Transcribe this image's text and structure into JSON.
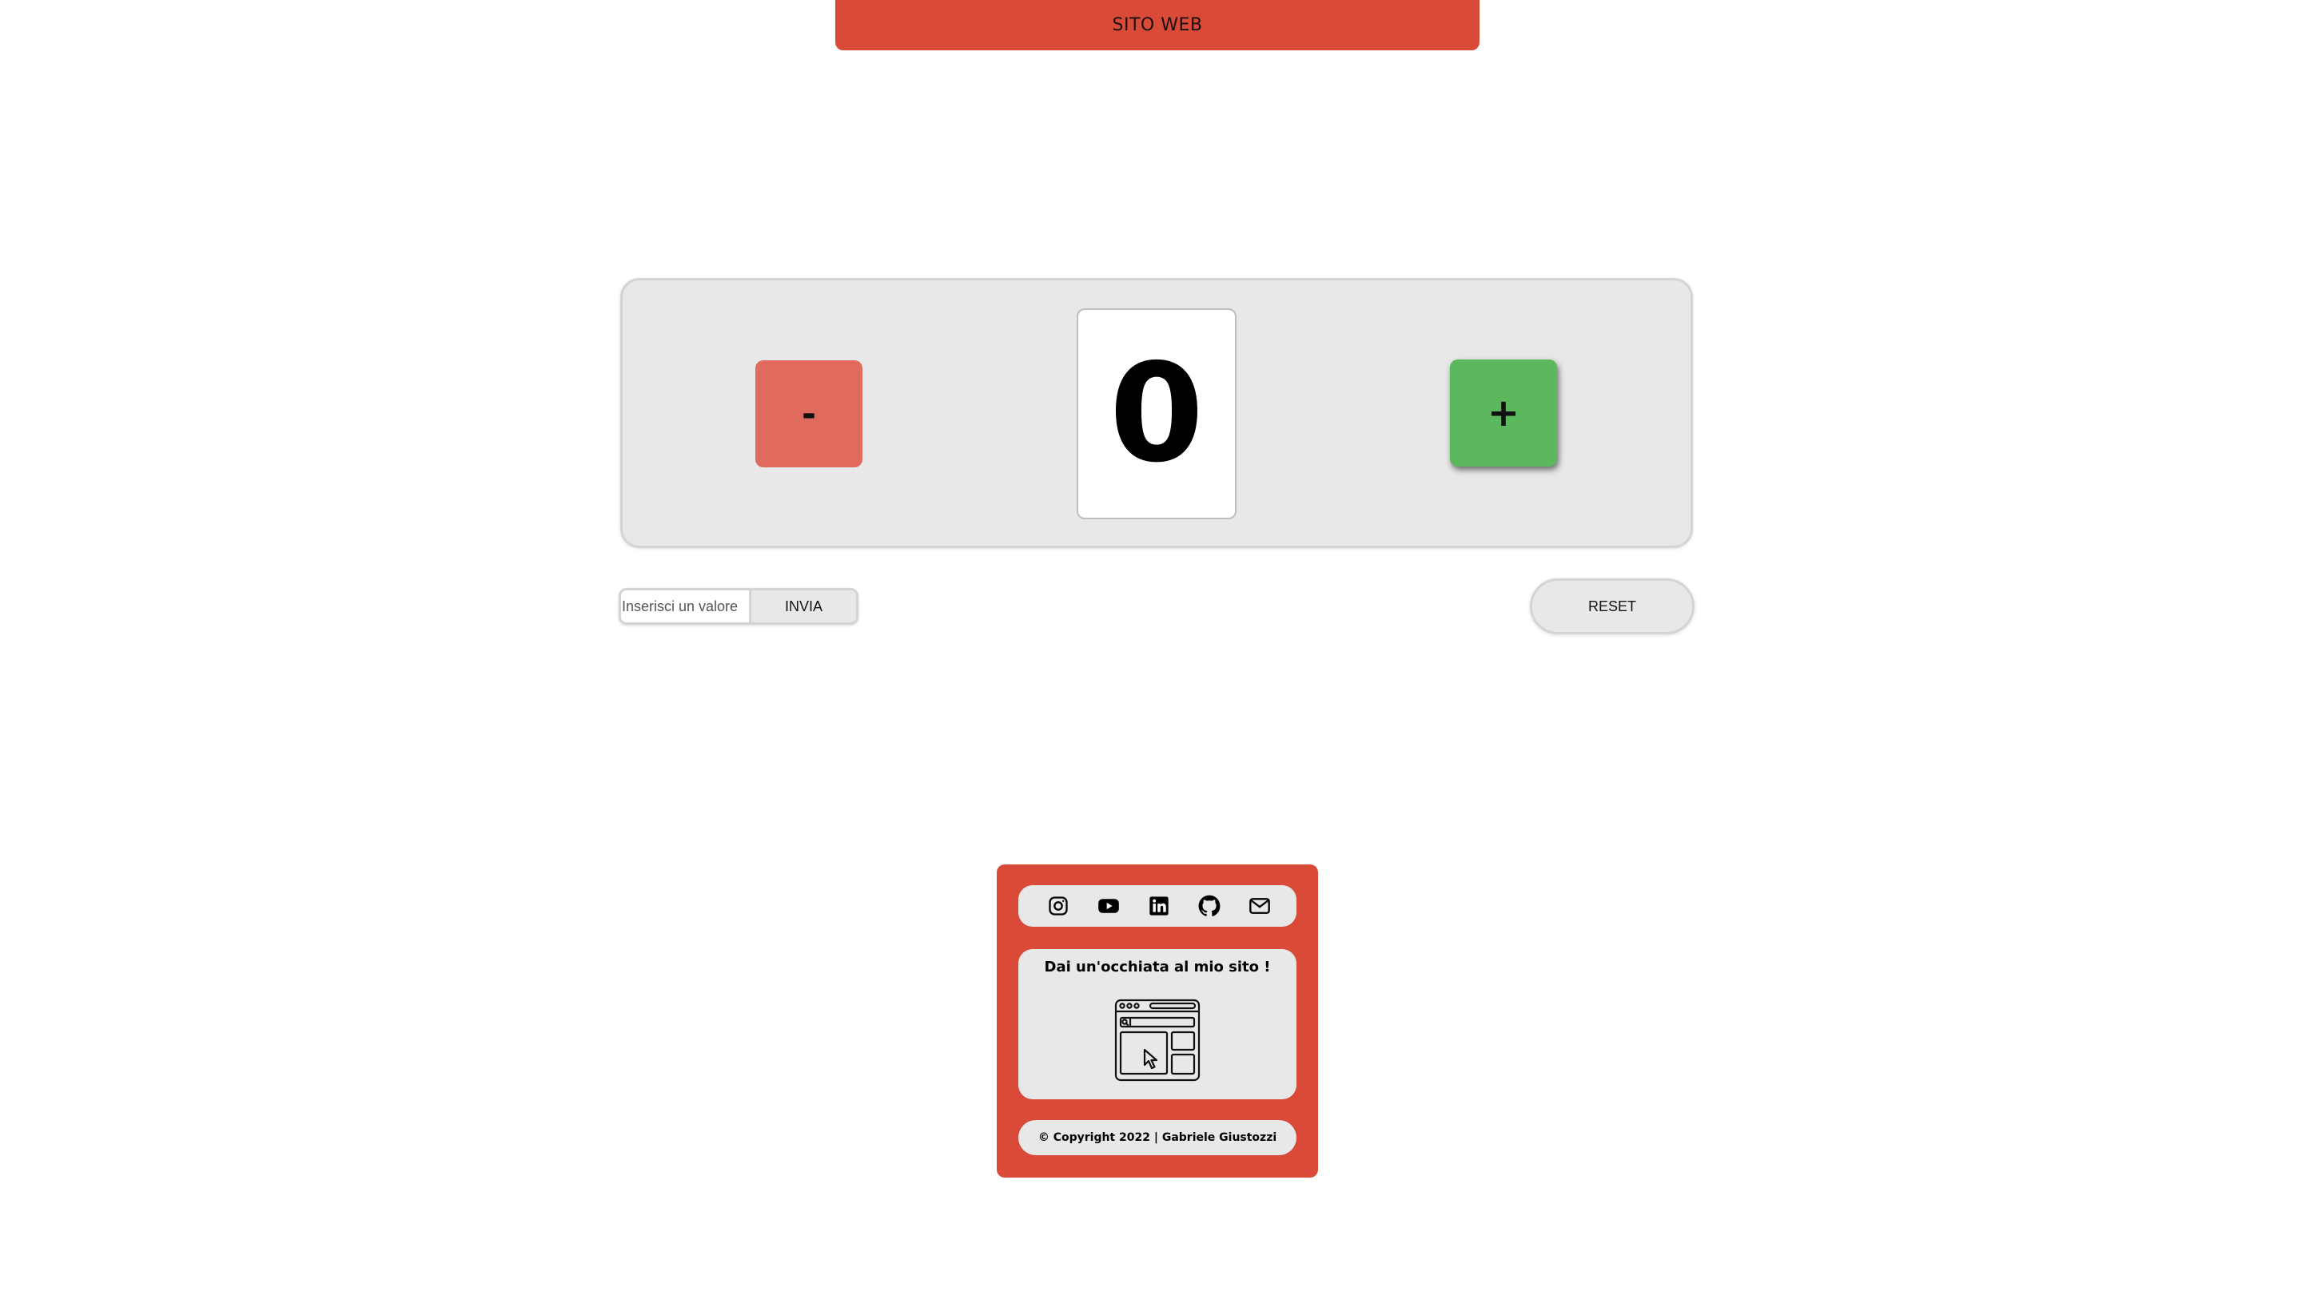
{
  "header": {
    "site_link_label": "SITO WEB"
  },
  "counter": {
    "decrement_label": "-",
    "value": "0",
    "increment_label": "+"
  },
  "controls": {
    "value_input_placeholder": "Inserisci un valore",
    "value_input_value": "",
    "send_label": "INVIA",
    "reset_label": "RESET"
  },
  "footer": {
    "social_icons": [
      "instagram-icon",
      "youtube-icon",
      "linkedin-icon",
      "github-icon",
      "mail-icon"
    ],
    "site_card_title": "Dai un'occhiata al mio sito !",
    "site_card_icon": "website-icon",
    "copyright": "© Copyright 2022 | Gabriele Giustozzi"
  },
  "colors": {
    "brand_red": "#d94a39",
    "minus_button": "#e06a5d",
    "plus_button": "#5cb85c",
    "panel_gray": "#e8e8e8"
  }
}
